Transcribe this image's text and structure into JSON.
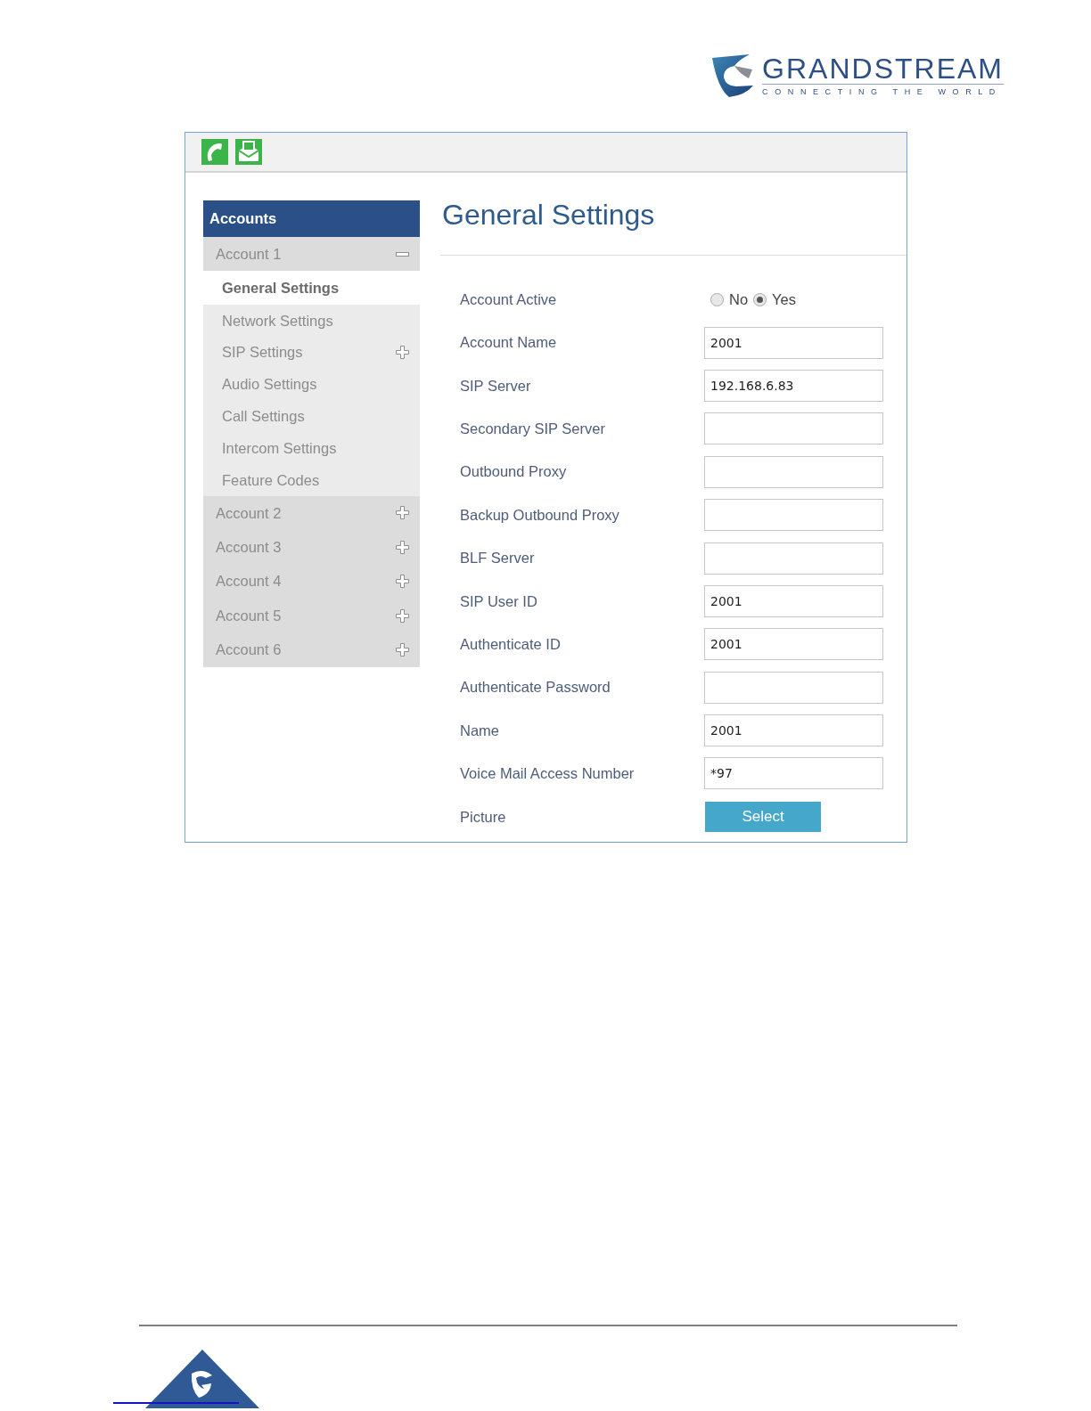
{
  "logo": {
    "name": "GRANDSTREAM",
    "tagline": "CONNECTING THE WORLD"
  },
  "sidebar": {
    "title": "Accounts",
    "accounts": [
      {
        "label": "Account 1",
        "expanded": true,
        "children": [
          {
            "label": "General Settings",
            "selected": true,
            "expandable": false
          },
          {
            "label": "Network Settings",
            "selected": false,
            "expandable": false
          },
          {
            "label": "SIP Settings",
            "selected": false,
            "expandable": true
          },
          {
            "label": "Audio Settings",
            "selected": false,
            "expandable": false
          },
          {
            "label": "Call Settings",
            "selected": false,
            "expandable": false
          },
          {
            "label": "Intercom Settings",
            "selected": false,
            "expandable": false
          },
          {
            "label": "Feature Codes",
            "selected": false,
            "expandable": false
          }
        ]
      },
      {
        "label": "Account 2",
        "expanded": false
      },
      {
        "label": "Account 3",
        "expanded": false
      },
      {
        "label": "Account 4",
        "expanded": false
      },
      {
        "label": "Account 5",
        "expanded": false
      },
      {
        "label": "Account 6",
        "expanded": false
      }
    ]
  },
  "page": {
    "title": "General Settings"
  },
  "form": {
    "rows": [
      {
        "kind": "radio",
        "label": "Account Active",
        "options": [
          {
            "label": "No",
            "selected": false
          },
          {
            "label": "Yes",
            "selected": true
          }
        ]
      },
      {
        "kind": "text",
        "label": "Account Name",
        "value": "2001"
      },
      {
        "kind": "text",
        "label": "SIP Server",
        "value": "192.168.6.83"
      },
      {
        "kind": "text",
        "label": "Secondary SIP Server"
      },
      {
        "kind": "text",
        "label": "Outbound Proxy"
      },
      {
        "kind": "text",
        "label": "Backup Outbound Proxy"
      },
      {
        "kind": "text",
        "label": "BLF Server"
      },
      {
        "kind": "text",
        "label": "SIP User ID",
        "value": "2001"
      },
      {
        "kind": "text",
        "label": "Authenticate ID",
        "value": "2001"
      },
      {
        "kind": "text",
        "label": "Authenticate Password"
      },
      {
        "kind": "text",
        "label": "Name",
        "value": "2001"
      },
      {
        "kind": "text",
        "label": "Voice Mail Access Number",
        "value": "*97"
      },
      {
        "kind": "button",
        "label": "Picture",
        "button": "Select"
      }
    ]
  }
}
